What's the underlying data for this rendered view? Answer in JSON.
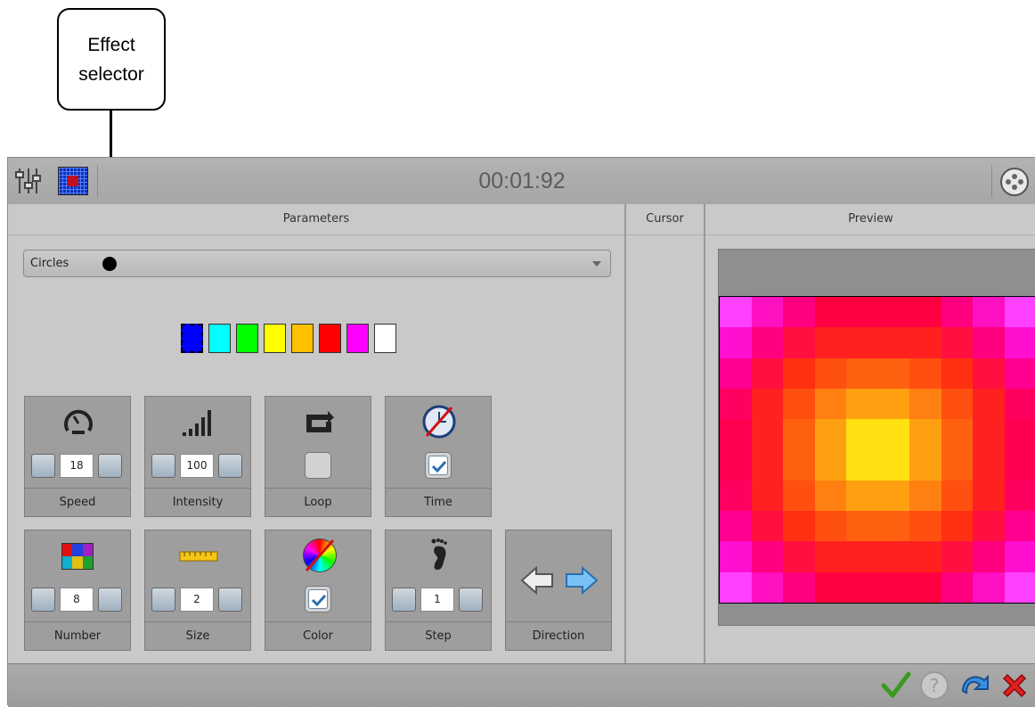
{
  "callout": {
    "line1": "Effect",
    "line2": "selector"
  },
  "toolbar": {
    "time": "00:01:92",
    "mixer_icon": "sliders-icon",
    "matrix_icon": "matrix-grid-icon",
    "dmx_icon": "dmx-connector-icon"
  },
  "panels": {
    "parameters": "Parameters",
    "cursor": "Cursor",
    "preview": "Preview"
  },
  "effect_selector": {
    "value": "Circles"
  },
  "colors": [
    "#0000ff",
    "#00ffff",
    "#00ff00",
    "#ffff00",
    "#ffc000",
    "#ff0000",
    "#ff00ff",
    "#ffffff"
  ],
  "selected_color_index": 0,
  "tiles": {
    "speed": {
      "label": "Speed",
      "value": "18",
      "icon": "speedometer-icon"
    },
    "intensity": {
      "label": "Intensity",
      "value": "100",
      "icon": "signal-bars-icon"
    },
    "loop": {
      "label": "Loop",
      "checked": false,
      "icon": "loop-icon"
    },
    "time": {
      "label": "Time",
      "checked": true,
      "icon": "clock-crossed-icon"
    },
    "number": {
      "label": "Number",
      "value": "8",
      "icon": "color-blocks-icon"
    },
    "size": {
      "label": "Size",
      "value": "2",
      "icon": "ruler-icon"
    },
    "color": {
      "label": "Color",
      "checked": true,
      "icon": "color-wheel-icon"
    },
    "step": {
      "label": "Step",
      "value": "1",
      "icon": "footprint-icon"
    },
    "direction": {
      "label": "Direction",
      "icon": "direction-arrows-icon"
    }
  },
  "preview_matrix": [
    [
      "#ff40ff",
      "#ff10c0",
      "#ff0080",
      "#ff0040",
      "#ff0040",
      "#ff0040",
      "#ff0040",
      "#ff0080",
      "#ff10c0",
      "#ff40ff"
    ],
    [
      "#ff10d0",
      "#ff0080",
      "#ff1040",
      "#ff2020",
      "#ff2020",
      "#ff2020",
      "#ff2020",
      "#ff1040",
      "#ff0080",
      "#ff10d0"
    ],
    [
      "#ff0090",
      "#ff1040",
      "#ff3010",
      "#ff5010",
      "#ff6010",
      "#ff6010",
      "#ff5010",
      "#ff3010",
      "#ff1040",
      "#ff0090"
    ],
    [
      "#ff0060",
      "#ff2020",
      "#ff5010",
      "#ff8010",
      "#ffa010",
      "#ffa010",
      "#ff8010",
      "#ff5010",
      "#ff2020",
      "#ff0060"
    ],
    [
      "#ff0050",
      "#ff2020",
      "#ff6010",
      "#ffa010",
      "#ffe010",
      "#ffe010",
      "#ffa010",
      "#ff6010",
      "#ff2020",
      "#ff0050"
    ],
    [
      "#ff0050",
      "#ff2020",
      "#ff6010",
      "#ffa010",
      "#ffe010",
      "#ffe010",
      "#ffa010",
      "#ff6010",
      "#ff2020",
      "#ff0050"
    ],
    [
      "#ff0060",
      "#ff2020",
      "#ff5010",
      "#ff8010",
      "#ffa010",
      "#ffa010",
      "#ff8010",
      "#ff5010",
      "#ff2020",
      "#ff0060"
    ],
    [
      "#ff0090",
      "#ff1040",
      "#ff3010",
      "#ff5010",
      "#ff6010",
      "#ff6010",
      "#ff5010",
      "#ff3010",
      "#ff1040",
      "#ff0090"
    ],
    [
      "#ff10d0",
      "#ff0080",
      "#ff1040",
      "#ff2020",
      "#ff2020",
      "#ff2020",
      "#ff2020",
      "#ff1040",
      "#ff0080",
      "#ff10d0"
    ],
    [
      "#ff40ff",
      "#ff10c0",
      "#ff0080",
      "#ff0040",
      "#ff0040",
      "#ff0040",
      "#ff0040",
      "#ff0080",
      "#ff10c0",
      "#ff40ff"
    ]
  ],
  "footer": {
    "ok_icon": "check-icon",
    "help_icon": "help-icon",
    "redo_icon": "redo-arrow-icon",
    "cancel_icon": "close-icon"
  }
}
